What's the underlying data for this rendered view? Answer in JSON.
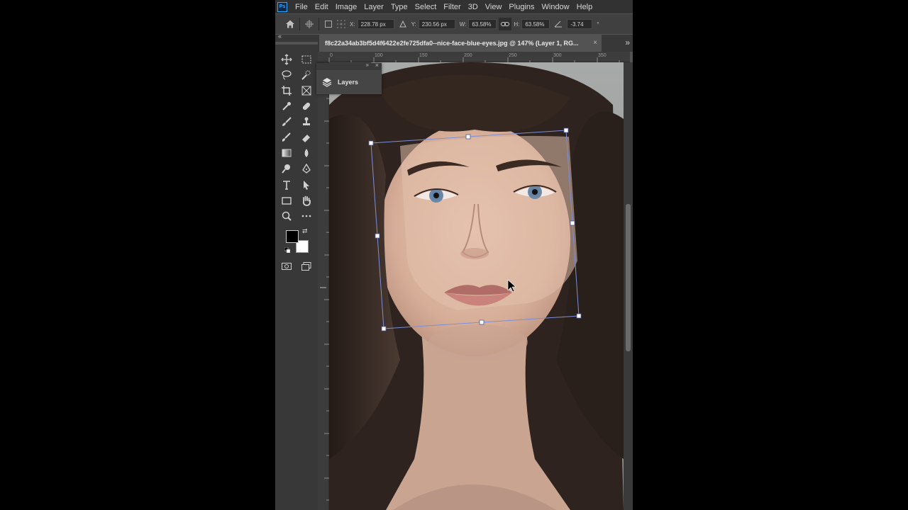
{
  "app": {
    "logo": "Ps"
  },
  "menu": [
    "File",
    "Edit",
    "Image",
    "Layer",
    "Type",
    "Select",
    "Filter",
    "3D",
    "View",
    "Plugins",
    "Window",
    "Help"
  ],
  "options": {
    "x_label": "X:",
    "x_value": "228.78 px",
    "y_label": "Y:",
    "y_value": "230.56 px",
    "w_label": "W:",
    "w_value": "63.58%",
    "h_label": "H:",
    "h_value": "63.58%",
    "angle_value": "-3.74",
    "angle_unit": "°"
  },
  "document": {
    "tab_title": "f8c22a34ab3bf5d4f6422e2fe725dfa0--nice-face-blue-eyes.jpg @ 147% (Layer 1, RG...",
    "close": "×"
  },
  "ruler": {
    "labels": [
      "0",
      "100",
      "150",
      "200",
      "250",
      "300",
      "350"
    ]
  },
  "layers_panel": {
    "tab_label": "Layers"
  },
  "colors": {
    "foreground": "#000000",
    "background": "#ffffff",
    "transform_box": "#7d8fd8"
  },
  "icons": {
    "home": "home-icon",
    "move": "move-icon",
    "marquee": "rect-marquee-icon",
    "lasso": "lasso-icon",
    "quick_select": "quick-selection-icon",
    "crop": "crop-icon",
    "frame": "frame-icon",
    "eyedropper": "eyedropper-icon",
    "healing": "healing-brush-icon",
    "brush": "brush-icon",
    "stamp": "clone-stamp-icon",
    "history_brush": "history-brush-icon",
    "eraser": "eraser-icon",
    "gradient": "gradient-icon",
    "blur": "blur-icon",
    "dodge": "dodge-icon",
    "pen": "pen-icon",
    "type": "type-icon",
    "path_select": "path-selection-icon",
    "shape": "rectangle-icon",
    "hand": "hand-icon",
    "zoom": "zoom-icon",
    "more": "more-icon",
    "quick_mask": "quick-mask-icon",
    "screen_mode": "screen-mode-icon"
  }
}
